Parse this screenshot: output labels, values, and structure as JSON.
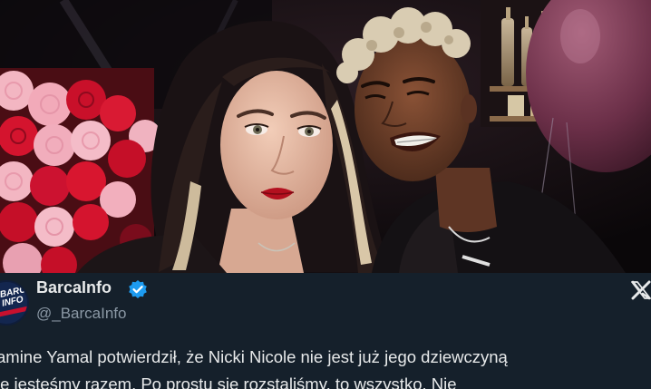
{
  "tweet": {
    "display_name": "BarcaInfo",
    "handle": "@_BarcaInfo",
    "avatar_text": "BARCA INFO",
    "avatar_icon": "barcainfo-logo-icon",
    "verified_icon": "verified-badge-icon",
    "platform_icon": "x-logo-icon",
    "text_lines": [
      "amine Yamal potwierdził, że Nicki Nicole nie jest już jego dziewczyną",
      "ie jesteśmy razem. Po prostu się rozstaliśmy, to wszystko. Nie"
    ]
  },
  "photo": {
    "icon": "couple-photo"
  },
  "colors": {
    "background": "#15202b",
    "text": "#e7e9ea",
    "secondary_text": "#8b98a5",
    "verified": "#1d9bf0",
    "avatar_bg": "#13264f"
  }
}
